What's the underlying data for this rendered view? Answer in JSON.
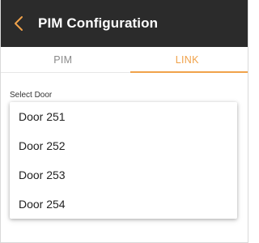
{
  "header": {
    "title": "PIM Configuration",
    "back_icon": "chevron-left-icon",
    "background_color": "#2b2b2b",
    "back_icon_color": "#f0a24a"
  },
  "tabs": [
    {
      "label": "PIM",
      "active": false
    },
    {
      "label": "LINK",
      "active": true
    }
  ],
  "accent_color": "#f0a24a",
  "select_door": {
    "label": "Select Door",
    "options": [
      "Door 251",
      "Door 252",
      "Door 253",
      "Door 254"
    ]
  }
}
